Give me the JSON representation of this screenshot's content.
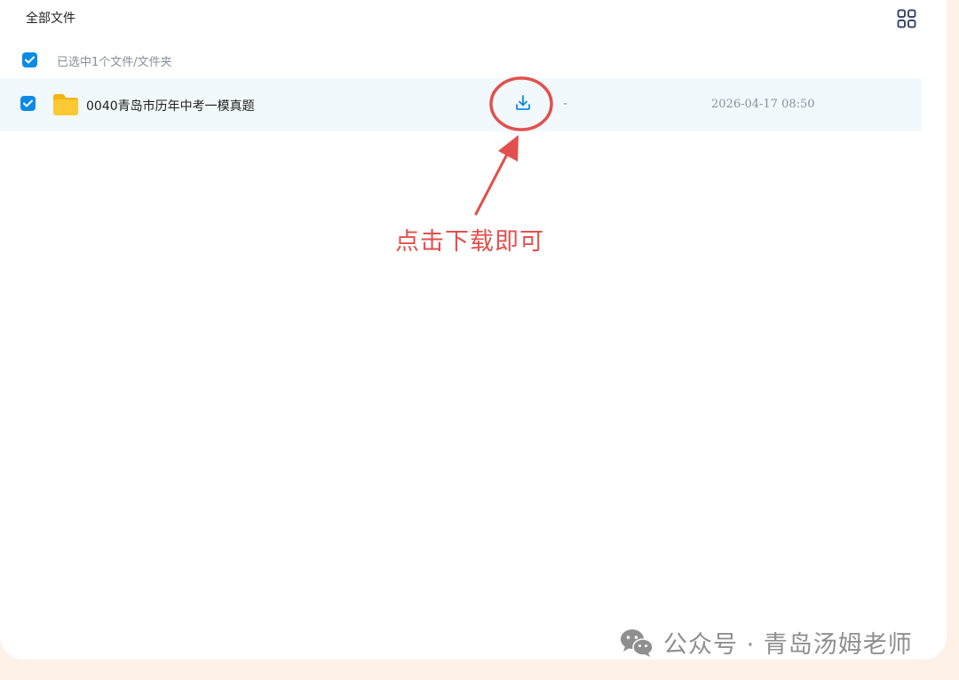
{
  "header": {
    "title": "全部文件",
    "grid_icon": "grid-view-icon"
  },
  "selection": {
    "label": "已选中1个文件/文件夹",
    "checked": true
  },
  "files": [
    {
      "name": "0040青岛市历年中考一模真题",
      "type": "folder",
      "size": "-",
      "modified": "2026-04-17 08:50",
      "checked": true
    }
  ],
  "annotation": {
    "text": "点击下载即可",
    "color": "#e2504d"
  },
  "watermark": {
    "text": "公众号 · 青岛汤姆老师",
    "icon": "wechat-icon"
  },
  "colors": {
    "accent": "#0b8be5",
    "folder": "#fbc531",
    "row_highlight": "#f2f9fd",
    "page_bg": "#fdf1e8"
  }
}
